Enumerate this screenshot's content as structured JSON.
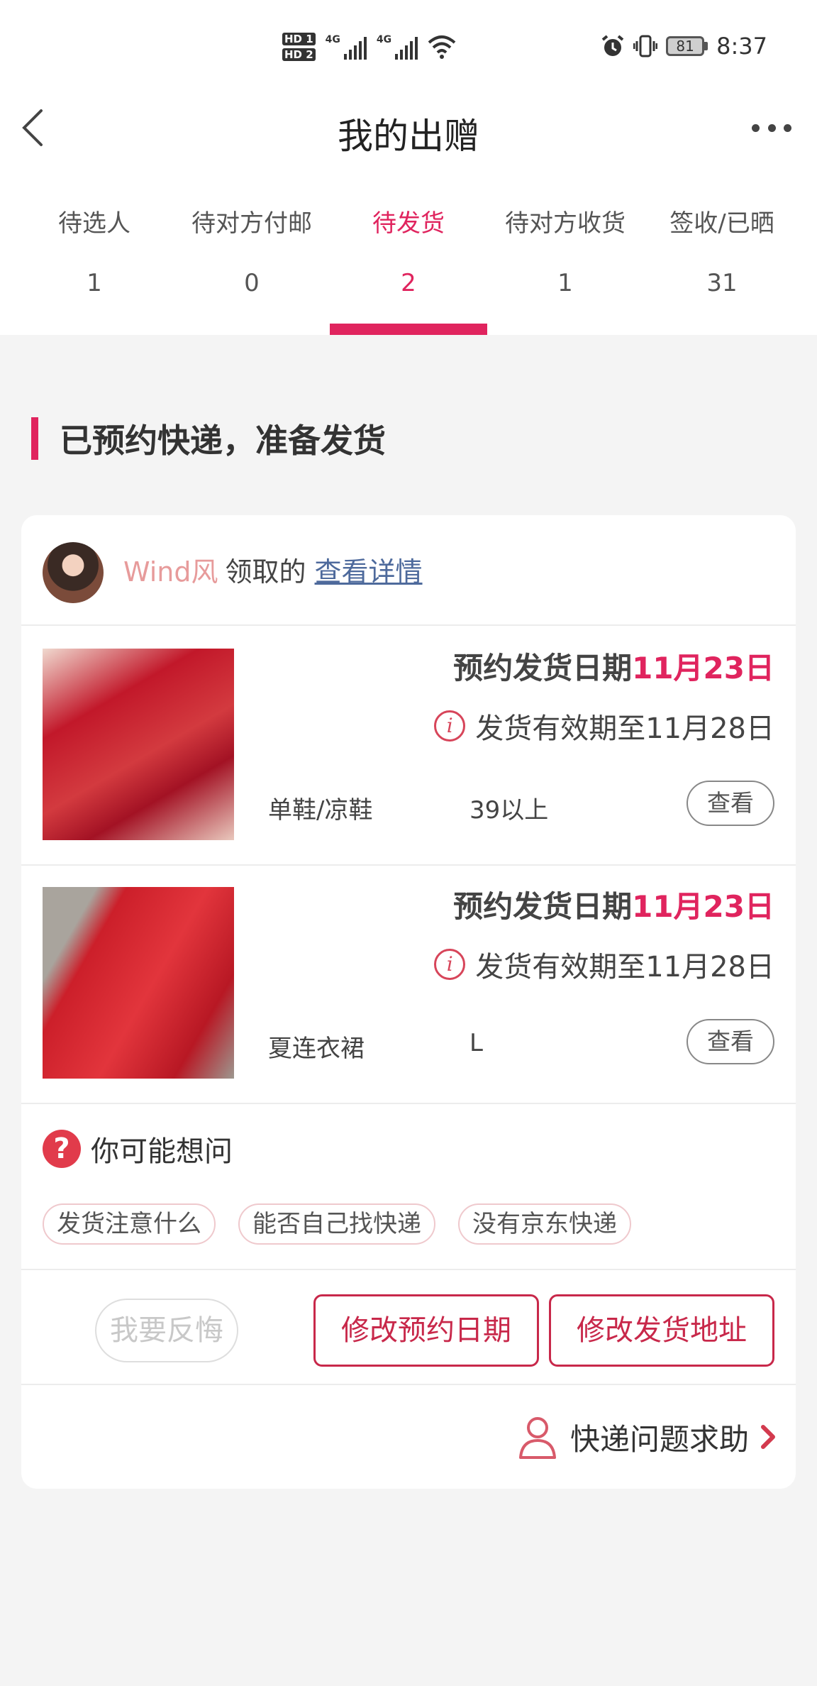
{
  "status_bar": {
    "hd1": "HD 1",
    "hd2": "HD 2",
    "net1": "4G",
    "net2": "4G",
    "battery": "81",
    "time": "8:37"
  },
  "nav": {
    "title": "我的出赠"
  },
  "tabs": [
    {
      "label": "待选人",
      "count": "1"
    },
    {
      "label": "待对方付邮",
      "count": "0"
    },
    {
      "label": "待发货",
      "count": "2"
    },
    {
      "label": "待对方收货",
      "count": "1"
    },
    {
      "label": "签收/已晒",
      "count": "31"
    }
  ],
  "section": {
    "title": "已预约快递，准备发货"
  },
  "card": {
    "username": "Wind风",
    "claim_verb": "领取的",
    "details_link": "查看详情",
    "items": [
      {
        "ship_label": "预约发货日期",
        "ship_date": "11月23日",
        "validity": "发货有效期至11月28日",
        "category": "单鞋/凉鞋",
        "size": "39以上",
        "view": "查看"
      },
      {
        "ship_label": "预约发货日期",
        "ship_date": "11月23日",
        "validity": "发货有效期至11月28日",
        "category": "夏连衣裙",
        "size": "L",
        "view": "查看"
      }
    ],
    "faq": {
      "icon": "?",
      "title": "你可能想问",
      "chips": [
        "发货注意什么",
        "能否自己找快递",
        "没有京东快递"
      ]
    },
    "actions": {
      "regret": "我要反悔",
      "change_date": "修改预约日期",
      "change_address": "修改发货地址"
    },
    "help": "快递问题求助"
  },
  "colors": {
    "accent": "#e0245e",
    "button_red": "#c8284a",
    "username": "#e79b9b",
    "link": "#4e6a9c"
  },
  "icons": [
    "back-icon",
    "more-icon",
    "alarm-icon",
    "vibrate-icon",
    "wifi-icon",
    "info-icon",
    "question-icon",
    "person-icon",
    "chevron-right-icon"
  ]
}
